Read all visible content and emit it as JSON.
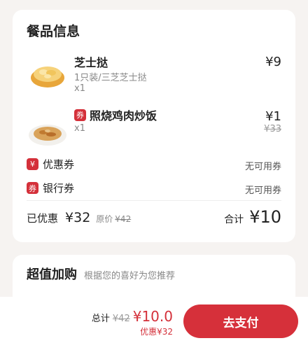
{
  "order": {
    "section_title": "餐品信息",
    "items": [
      {
        "name": "芝士挞",
        "desc": "1只装/三芝芝士挞",
        "qty": "x1",
        "price": "¥9"
      },
      {
        "tag": "券",
        "name": "照烧鸡肉炒饭",
        "qty": "x1",
        "price": "¥1",
        "original_price": "¥33"
      }
    ],
    "coupon": {
      "tag": "¥",
      "label": "优惠券",
      "value": "无可用券"
    },
    "bank": {
      "tag": "券",
      "label": "银行券",
      "value": "无可用券"
    },
    "summary": {
      "discount_label": "已优惠",
      "discount_amount": "¥32",
      "original_label": "原价",
      "original_price": "¥42",
      "total_label": "合计",
      "total": "¥10"
    }
  },
  "upsell": {
    "title": "超值加购",
    "subtitle": "根据您的喜好为您推荐"
  },
  "bottom_bar": {
    "total_label": "总计",
    "original": "¥42",
    "total": "¥10.0",
    "discount": "优惠¥32",
    "pay_button": "去支付"
  },
  "colors": {
    "accent_red": "#d6303a",
    "background": "#f6f3f1"
  },
  "icons": {
    "item1_image": "cheese-tart-icon",
    "item2_image": "fried-rice-icon"
  }
}
